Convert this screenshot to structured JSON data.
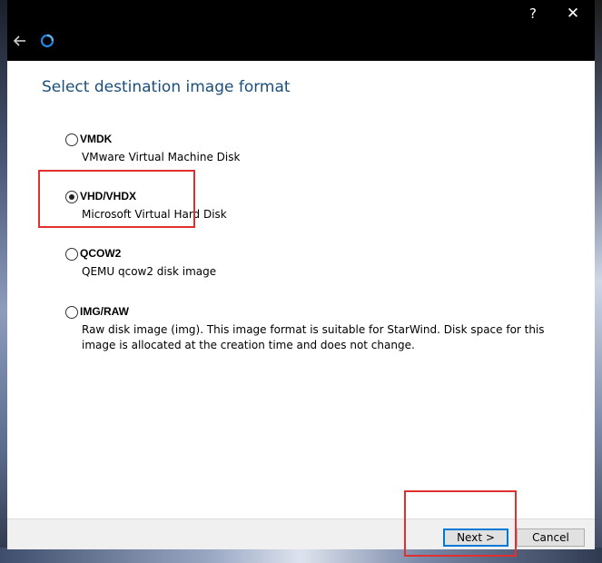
{
  "titlebar": {
    "help_label": "?",
    "close_label": "✕"
  },
  "page": {
    "heading": "Select destination image format"
  },
  "options": [
    {
      "title": "VMDK",
      "description": "VMware Virtual Machine Disk",
      "selected": false
    },
    {
      "title": "VHD/VHDX",
      "description": "Microsoft Virtual Hard Disk",
      "selected": true
    },
    {
      "title": "QCOW2",
      "description": "QEMU qcow2 disk image",
      "selected": false
    },
    {
      "title": "IMG/RAW",
      "description": "Raw disk image (img). This image format is suitable for StarWind. Disk space for this image is allocated at the creation time and does not change.",
      "selected": false
    }
  ],
  "footer": {
    "next_label": "Next >",
    "cancel_label": "Cancel"
  },
  "colors": {
    "heading": "#1b4f7a",
    "highlight": "#e03030",
    "focus_border": "#0078d7"
  }
}
